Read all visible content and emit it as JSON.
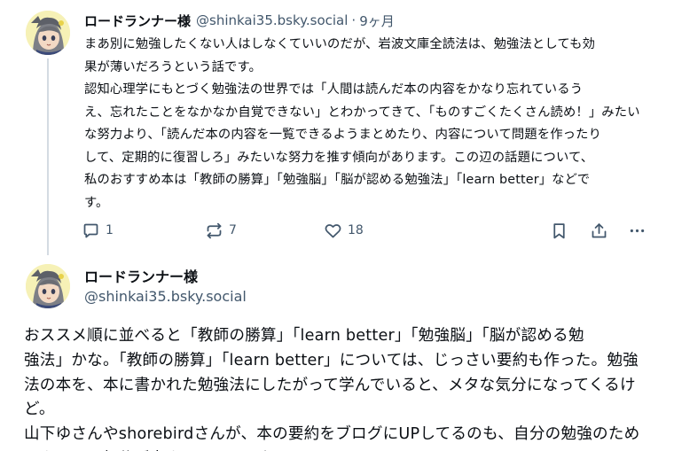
{
  "post1": {
    "display_name": "ロードランナー様",
    "handle": "@shinkai35.bsky.social",
    "separator": "·",
    "time": "9ヶ月",
    "text": "まあ別に勉強したくない人はしなくていいのだが、岩波文庫全読法は、勉強法としても効\n果が薄いだろうという話です。\n認知心理学にもとづく勉強法の世界では「人間は読んだ本の内容をかなり忘れているう\nえ、忘れたことをなかなか自覚できない」とわかってきて、「ものすごくたくさん読め！」みたい\nな努力より、「読んだ本の内容を一覧できるようまとめたり、内容について問題を作ったり\nして、定期的に復習しろ」みたいな努力を推す傾向があります。この辺の話題について、\n私のおすすめ本は「教師の勝算」「勉強脳」「脳が認める勉強法」「learn better」などで\nす。",
    "actions": {
      "reply_count": "1",
      "repost_count": "7",
      "like_count": "18"
    },
    "icons": {
      "reply": "reply-icon",
      "repost": "repost-icon",
      "like": "heart-icon",
      "bookmark": "bookmark-icon",
      "share": "share-icon",
      "more": "more-icon"
    }
  },
  "post2": {
    "display_name": "ロードランナー様",
    "handle": "@shinkai35.bsky.social",
    "text": "おススメ順に並べると「教師の勝算」「learn better」「勉強脳」「脳が認める勉\n強法」かな。「教師の勝算」「learn better」については、じっさい要約も作った。勉強\n法の本を、本に書かれた勉強法にしたがって学んでいると、メタな気分になってくるけど。\n山下ゆさんやshorebirdさんが、本の要約をブログにUPしてるのも、自分の勉強のため\nにやってる部分が大きいんだろうな。"
  },
  "colors": {
    "text": "#0b0f14",
    "muted": "#42576c",
    "thread_line": "#d4dbe2",
    "avatar_bg": "#f6f1b6"
  }
}
